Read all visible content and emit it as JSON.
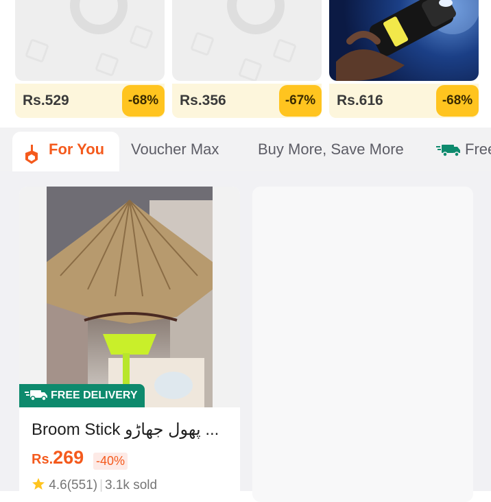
{
  "deals": [
    {
      "price": "Rs.529",
      "discount": "-68%"
    },
    {
      "price": "Rs.356",
      "discount": "-67%"
    },
    {
      "price": "Rs.616",
      "discount": "-68%"
    }
  ],
  "tabs": {
    "for_you": "For You",
    "voucher_max": "Voucher Max",
    "buy_more": "Buy More, Save More",
    "free": "Free"
  },
  "colors": {
    "accent": "#f45a1d",
    "badge": "#ffc41f",
    "delivery": "#0e8a6d"
  },
  "product": {
    "badge": "FREE DELIVERY",
    "title": "Broom Stick پھول جھاڑو ...",
    "currency": "Rs.",
    "price": "269",
    "discount": "-40%",
    "rating": "4.6",
    "reviews": "(551)",
    "sold": "3.1k sold"
  }
}
